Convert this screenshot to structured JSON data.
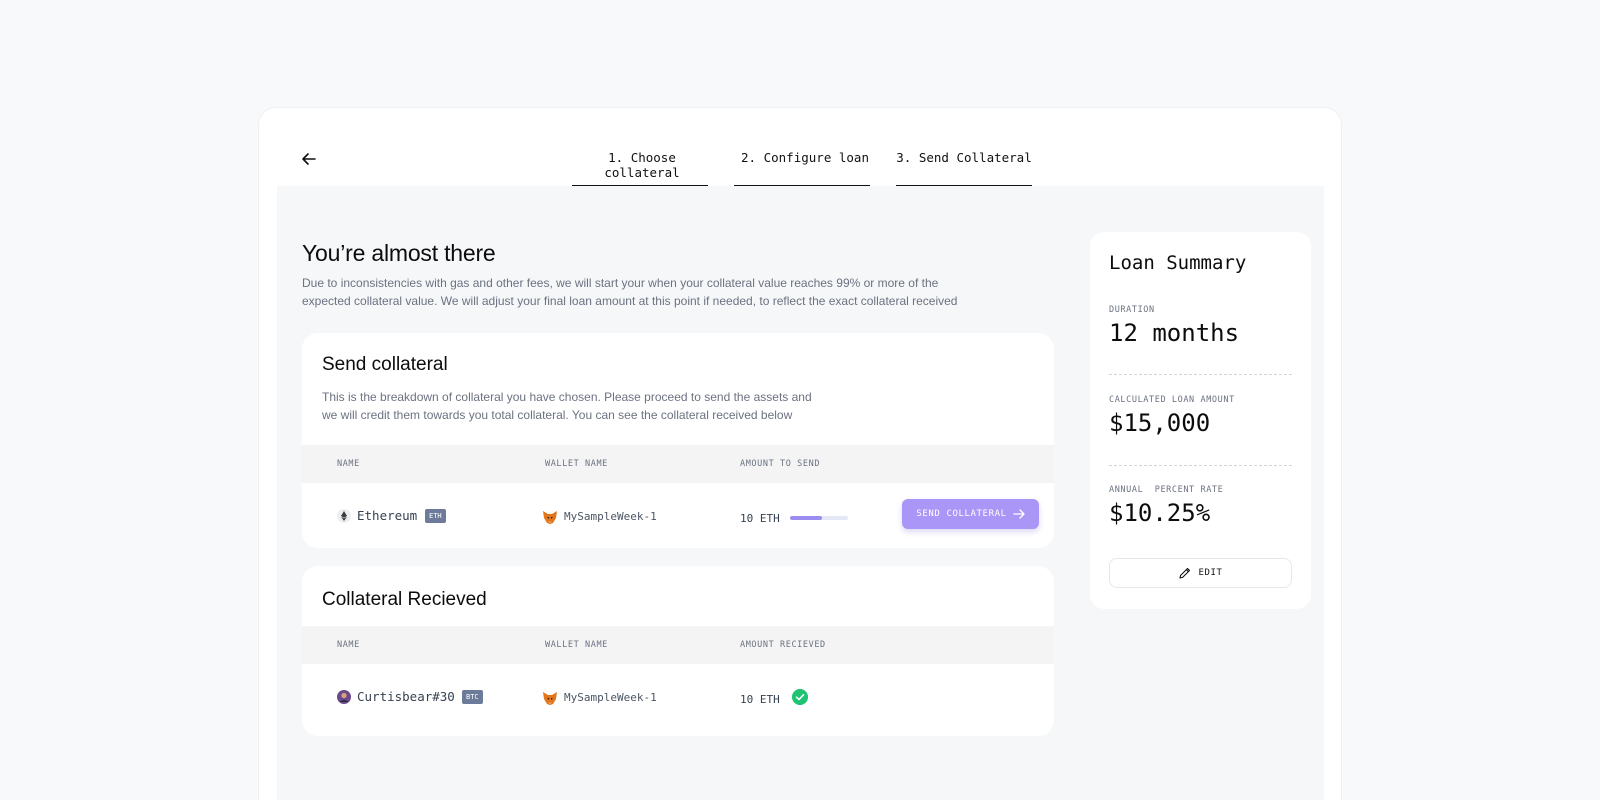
{
  "stepper": {
    "steps": [
      {
        "label": "1. Choose collateral"
      },
      {
        "label": "2. Configure loan"
      },
      {
        "label": "3. Send Collateral"
      }
    ]
  },
  "main": {
    "title": "You’re almost there",
    "description": "Due to inconsistencies with gas and other fees, we will start your when your collateral value reaches 99% or more of the expected collateral value. We will adjust your final loan amount at this point if needed, to reflect the exact collateral received"
  },
  "send_section": {
    "title": "Send collateral",
    "description": "This is the breakdown of collateral you have chosen. Please proceed to send the assets and we will credit them towards you total collateral. You can see the collateral received below",
    "columns": {
      "name": "NAME",
      "wallet": "WALLET NAME",
      "amount": "AMOUNT TO SEND"
    },
    "rows": [
      {
        "asset": "Ethereum",
        "tag": "ETH",
        "wallet": "MySampleWeek-1",
        "amount": "10 ETH",
        "progress": 0.55,
        "button": "SEND COLLATERAL"
      }
    ]
  },
  "received_section": {
    "title": "Collateral Recieved",
    "columns": {
      "name": "NAME",
      "wallet": "WALLET NAME",
      "amount": "AMOUNT RECIEVED"
    },
    "rows": [
      {
        "asset": "Curtisbear#30",
        "tag": "BTC",
        "wallet": "MySampleWeek-1",
        "amount": "10 ETH"
      }
    ]
  },
  "summary": {
    "title": "Loan Summary",
    "duration_label": "DURATION",
    "duration_value": "12 months",
    "amount_label": "CALCULATED LOAN AMOUNT",
    "amount_value": "$15,000",
    "rate_label": "ANNUAL  PERCENT RATE",
    "rate_value": "$10.25%",
    "edit_label": "EDIT"
  },
  "colors": {
    "accent": "#a996f6",
    "success": "#1fc472",
    "tag": "#6b7b99"
  },
  "icons": [
    "back-arrow-icon",
    "ethereum-icon",
    "metamask-fox-icon",
    "arrow-right-icon",
    "avatar-icon",
    "check-circle-icon",
    "pencil-icon"
  ]
}
